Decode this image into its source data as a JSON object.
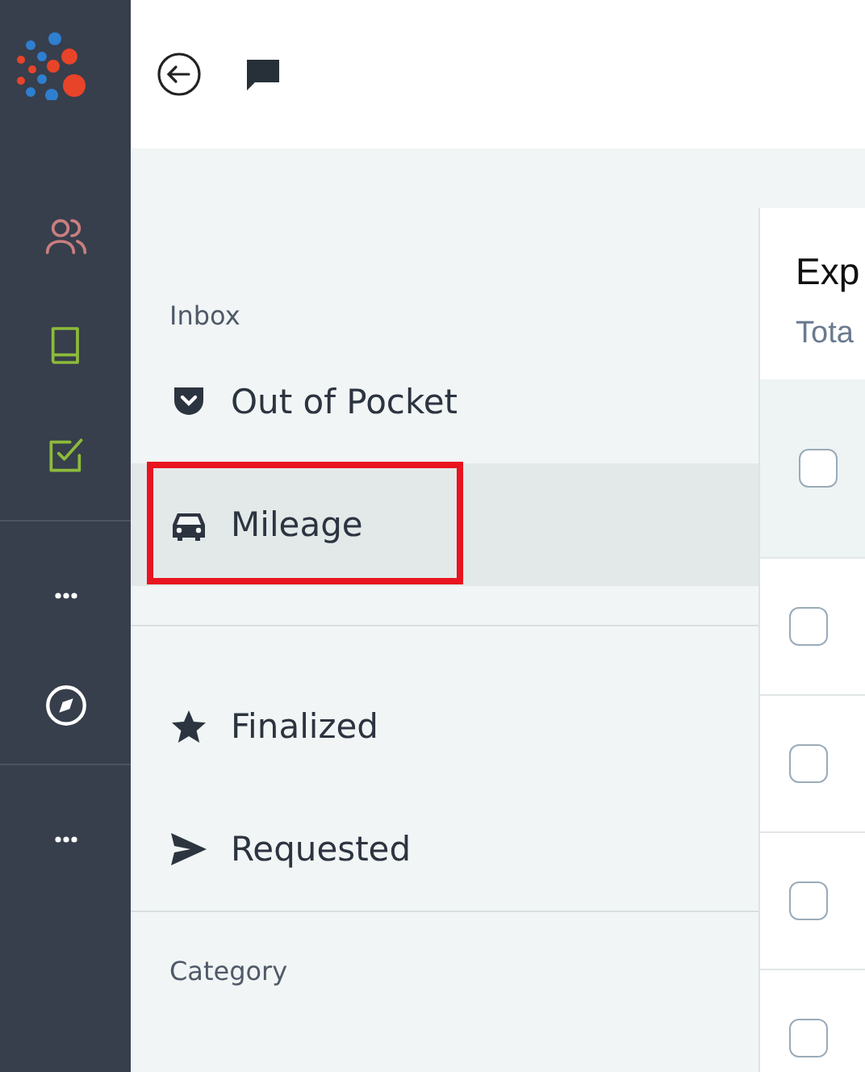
{
  "rail": {
    "groups": [
      [
        {
          "kind": "people",
          "color": "#c97f7f"
        },
        {
          "kind": "book",
          "color": "#8dbb3a"
        },
        {
          "kind": "task",
          "color": "#8dbb3a"
        }
      ],
      [
        {
          "kind": "more",
          "color": "#ffffff"
        },
        {
          "kind": "compass",
          "color": "#ffffff"
        }
      ],
      [
        {
          "kind": "more",
          "color": "#ffffff"
        }
      ]
    ]
  },
  "nav": {
    "sections": [
      {
        "heading": "Inbox",
        "items": [
          {
            "kind": "pocket",
            "label": "Out of Pocket",
            "selected": false
          },
          {
            "kind": "car",
            "label": "Mileage",
            "selected": true,
            "highlighted": true
          }
        ]
      },
      {
        "items": [
          {
            "kind": "star",
            "label": "Finalized",
            "selected": false
          },
          {
            "kind": "send",
            "label": "Requested",
            "selected": false
          }
        ]
      },
      {
        "heading": "Category"
      }
    ]
  },
  "content": {
    "title": "Exp",
    "subtitle": "Tota",
    "header_checked": false,
    "rows": [
      {
        "checked": false
      },
      {
        "checked": false
      },
      {
        "checked": false
      },
      {
        "checked": false
      }
    ]
  }
}
